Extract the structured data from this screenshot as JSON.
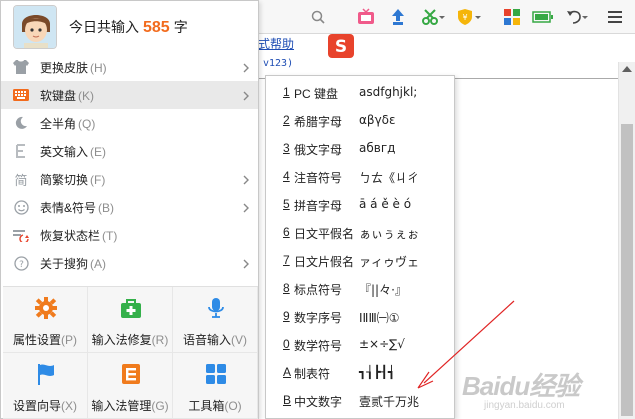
{
  "background": {
    "link_text": "式帮助",
    "version_text": "v123)",
    "watermark": "Baidu经验",
    "watermark_sub": "jingyan.baidu.com"
  },
  "header": {
    "prefix": "今日共输入",
    "count": "585",
    "suffix": "字"
  },
  "menu": {
    "items": [
      {
        "label": "更换皮肤",
        "key": "(H)",
        "icon": "tshirt-icon",
        "submenu": true
      },
      {
        "label": "软键盘",
        "key": "(K)",
        "icon": "keyboard-icon",
        "submenu": true
      },
      {
        "label": "全半角",
        "key": "(Q)",
        "icon": "moon-icon",
        "submenu": false
      },
      {
        "label": "英文输入",
        "key": "(E)",
        "icon": "english-e-icon",
        "submenu": false
      },
      {
        "label": "简繁切换",
        "key": "(F)",
        "icon": "jian-char-icon",
        "submenu": true
      },
      {
        "label": "表情&符号",
        "key": "(B)",
        "icon": "smiley-icon",
        "submenu": true
      },
      {
        "label": "恢复状态栏",
        "key": "(T)",
        "icon": "statusbar-icon",
        "submenu": false
      },
      {
        "label": "关于搜狗",
        "key": "(A)",
        "icon": "question-icon",
        "submenu": true
      }
    ],
    "grid": [
      {
        "label": "属性设置",
        "key": "(P)",
        "icon": "gear-icon",
        "color": "#f07b1d"
      },
      {
        "label": "输入法修复",
        "key": "(R)",
        "icon": "repair-bag-icon",
        "color": "#34b04a"
      },
      {
        "label": "语音输入",
        "key": "(V)",
        "icon": "microphone-icon",
        "color": "#2e8be6"
      },
      {
        "label": "设置向导",
        "key": "(X)",
        "icon": "flag-icon",
        "color": "#2e8be6"
      },
      {
        "label": "输入法管理",
        "key": "(G)",
        "icon": "manage-list-icon",
        "color": "#f07b1d"
      },
      {
        "label": "工具箱",
        "key": "(O)",
        "icon": "toolbox-grid-icon",
        "color": "#2e8be6"
      }
    ]
  },
  "submenu": {
    "items": [
      {
        "num": "1",
        "label": "PC 键盘",
        "sample": "asdfghjkl;"
      },
      {
        "num": "2",
        "label": "希腊字母",
        "sample": "αβγδε"
      },
      {
        "num": "3",
        "label": "俄文字母",
        "sample": "абвгд"
      },
      {
        "num": "4",
        "label": "注音符号",
        "sample": "ㄅㄊ《ㄐㄔ"
      },
      {
        "num": "5",
        "label": "拼音字母",
        "sample": "ā á ě è ó"
      },
      {
        "num": "6",
        "label": "日文平假名",
        "sample": "ぁぃぅぇぉ"
      },
      {
        "num": "7",
        "label": "日文片假名",
        "sample": "ァィゥヴェ"
      },
      {
        "num": "8",
        "label": "标点符号",
        "sample": "『||々·』"
      },
      {
        "num": "9",
        "label": "数字序号",
        "sample": "ⅠⅡⅢ㈠①"
      },
      {
        "num": "0",
        "label": "数学符号",
        "sample": "±×÷∑√"
      },
      {
        "num": "A",
        "label": "制表符",
        "sample": "┓┧┣┨┪"
      },
      {
        "num": "B",
        "label": "中文数字",
        "sample": "壹贰千万兆"
      }
    ]
  },
  "colors": {
    "accent_orange": "#f26b1d",
    "highlight_bg": "#e9e9e9",
    "arrow_red": "#e02424"
  }
}
